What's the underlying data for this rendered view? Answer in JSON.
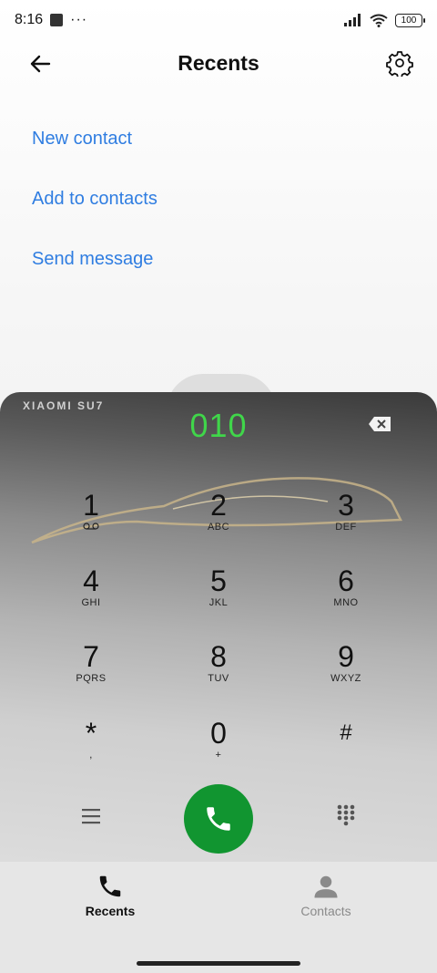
{
  "status_bar": {
    "time": "8:16",
    "more": "···",
    "battery": "100"
  },
  "header": {
    "title": "Recents"
  },
  "actions": {
    "new_contact": "New contact",
    "add_to_contacts": "Add to contacts",
    "send_message": "Send message"
  },
  "dialpad": {
    "brand": "XIAOMI SU7",
    "number": "010",
    "keys": [
      {
        "digit": "1",
        "letters": ""
      },
      {
        "digit": "2",
        "letters": "ABC"
      },
      {
        "digit": "3",
        "letters": "DEF"
      },
      {
        "digit": "4",
        "letters": "GHI"
      },
      {
        "digit": "5",
        "letters": "JKL"
      },
      {
        "digit": "6",
        "letters": "MNO"
      },
      {
        "digit": "7",
        "letters": "PQRS"
      },
      {
        "digit": "8",
        "letters": "TUV"
      },
      {
        "digit": "9",
        "letters": "WXYZ"
      },
      {
        "digit": "*",
        "letters": ","
      },
      {
        "digit": "0",
        "letters": "+"
      },
      {
        "digit": "#",
        "letters": ""
      }
    ]
  },
  "bottom_nav": {
    "recents": "Recents",
    "contacts": "Contacts"
  },
  "colors": {
    "accent_link": "#2f7de1",
    "dial_number": "#40d64a",
    "call_button": "#119530"
  }
}
